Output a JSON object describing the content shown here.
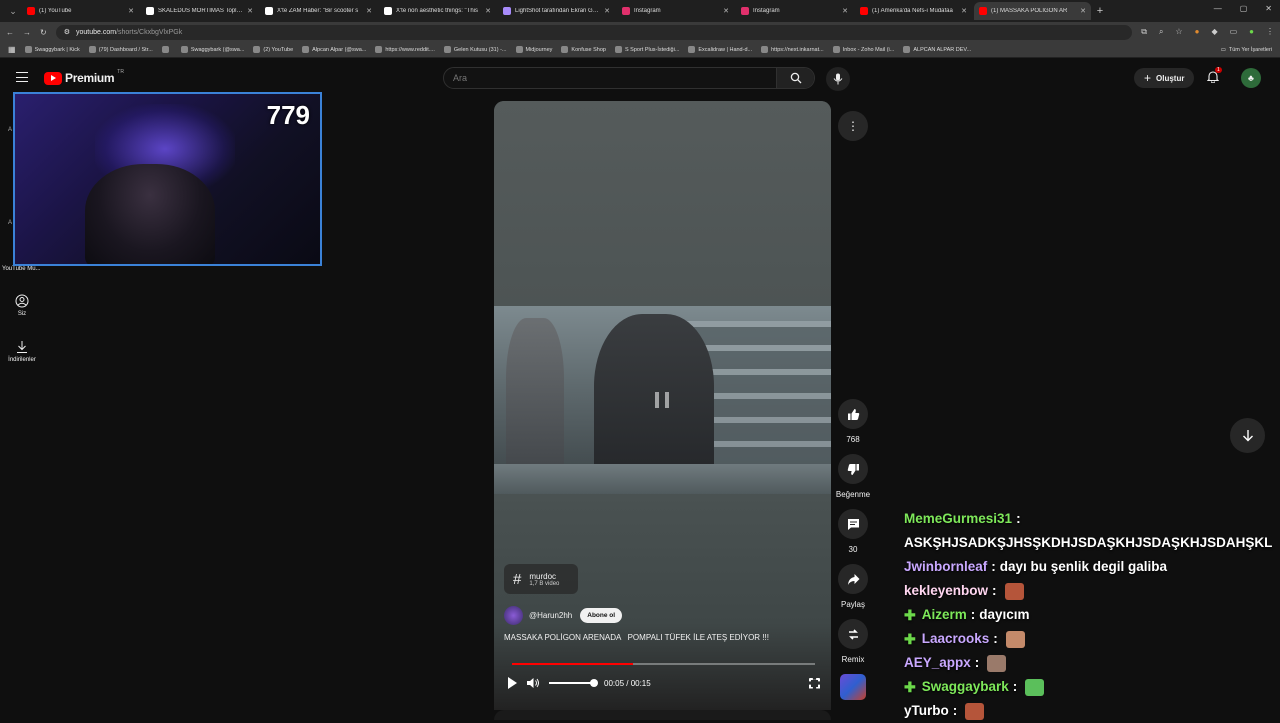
{
  "browser": {
    "tabs": [
      {
        "title": "(1) YouTube",
        "color": "#ff0000"
      },
      {
        "title": "SKALEDUS MORTIMAS Topluluk",
        "color": "#ffffff"
      },
      {
        "title": "X'te ZAM Haber: \"Bir scooter s",
        "color": "#ffffff"
      },
      {
        "title": "X'te non aesthetic things: \"This",
        "color": "#ffffff"
      },
      {
        "title": "LightShot tarafından Ekran Görü",
        "color": "#a78bfa"
      },
      {
        "title": "Instagram",
        "color": "#e1306c"
      },
      {
        "title": "Instagram",
        "color": "#e1306c"
      },
      {
        "title": "(1) Amerika'da Nefs-i Müdafaa",
        "color": "#ff0000"
      },
      {
        "title": "(1) MASSAKA POLİGON AR",
        "color": "#ff0000"
      }
    ],
    "url_host": "youtube.com",
    "url_path": "/shorts/CkxbgVlxPGk",
    "bookmarks": [
      "Swaggybark | Kick",
      "(79) Dashboard / Str...",
      "",
      "Swaggybark (@swa...",
      "(2) YouTube",
      "Alpcan Alpar (@swa...",
      "https://www.reddit....",
      "Gelen Kutusu (31) -...",
      "Midjourney",
      "Konfuse Shop",
      "S Sport Plus-İstediği...",
      "Excalidraw | Hand-d...",
      "https://next.inkarnat...",
      "Inbox - Zoho Mail (i...",
      "ALPCAN ALPAR DEV..."
    ],
    "bookmarks_right": "Tüm Yer İşaretleri"
  },
  "header": {
    "logo_text": "Premium",
    "logo_region": "TR",
    "search_placeholder": "Ara",
    "create_label": "Oluştur",
    "notification_count": "1"
  },
  "webcam": {
    "viewer_count": "779"
  },
  "sidebar": {
    "label_a1": "A",
    "label_a2": "A",
    "music_label": "YouTube Mu...",
    "you_label": "Siz",
    "downloads_label": "İndirilenler"
  },
  "short": {
    "tag_name": "murdoc",
    "tag_count": "1,7 B video",
    "channel_name": "@Harun2hh",
    "subscribe_label": "Abone ol",
    "title": "MASSAKA POLİGON ARENADA   POMPALI TÜFEK İLE ATEŞ EDİYOR !!!",
    "progress": 0.4,
    "time": "00:05 / 00:15"
  },
  "actions": {
    "like_count": "768",
    "dislike_label": "Beğenme",
    "comment_count": "30",
    "share_label": "Paylaş",
    "remix_label": "Remix"
  },
  "chat": [
    {
      "user": "MemeGurmesi31",
      "color": "#7ee85a",
      "text": "ASKŞHJSADKŞJHSŞKDHJSDAŞKHJSDAŞKHJSDAHŞKL",
      "badge": false,
      "emote": ""
    },
    {
      "user": "Jwinbornleaf",
      "color": "#c9a8ff",
      "text": "dayı bu şenlik degil galiba",
      "badge": false,
      "emote": ""
    },
    {
      "user": "kekleyenbow",
      "color": "#ffd6f0",
      "text": "",
      "badge": false,
      "emote": "#b5553a"
    },
    {
      "user": "Aizerm",
      "color": "#7ee85a",
      "text": "dayıcım",
      "badge": true,
      "emote": ""
    },
    {
      "user": "Laacrooks",
      "color": "#c9a8ff",
      "text": "",
      "badge": true,
      "emote": "#c48a6a"
    },
    {
      "user": "AEY_appx",
      "color": "#c9a8ff",
      "text": "",
      "badge": false,
      "emote": "#9a7a6a"
    },
    {
      "user": "Swaggaybark",
      "color": "#7ee85a",
      "text": "",
      "badge": true,
      "emote": "#5bbf5b"
    },
    {
      "user": "yTurbo",
      "color": "#ffffff",
      "text": "",
      "badge": false,
      "emote": "#b5553a"
    }
  ]
}
